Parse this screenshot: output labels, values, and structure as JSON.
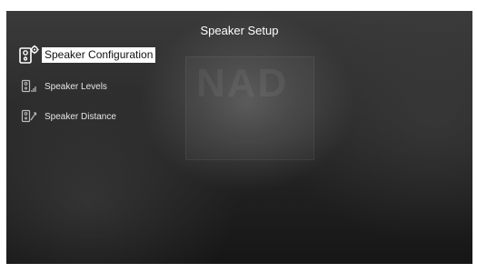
{
  "screen": {
    "title": "Speaker Setup",
    "background_logo": "NAD"
  },
  "menu": {
    "items": [
      {
        "label": "Speaker Configuration",
        "icon": "speaker-gear-icon",
        "selected": true
      },
      {
        "label": "Speaker Levels",
        "icon": "speaker-levels-icon",
        "selected": false
      },
      {
        "label": "Speaker Distance",
        "icon": "speaker-distance-icon",
        "selected": false
      }
    ]
  },
  "colors": {
    "highlight_bg": "#ffffff",
    "highlight_text": "#111111",
    "text": "#e6e6e6"
  }
}
